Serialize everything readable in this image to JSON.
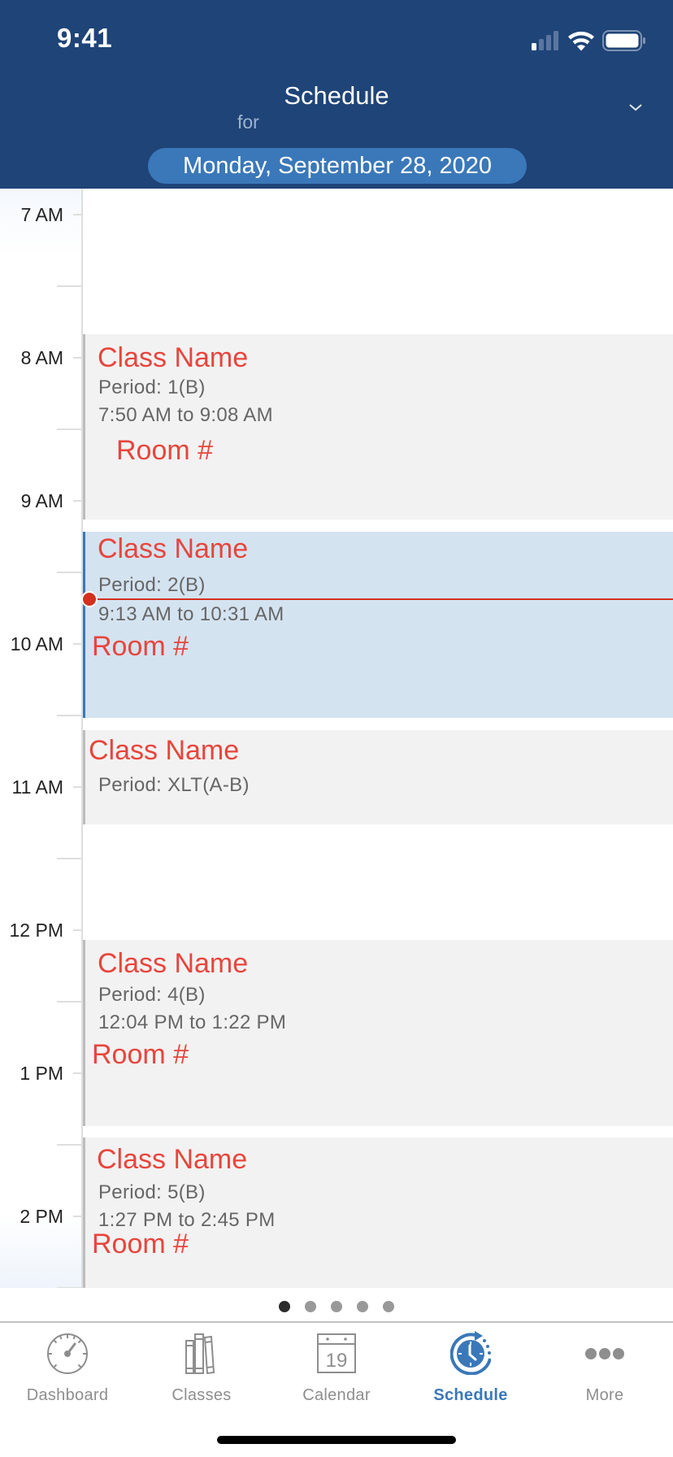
{
  "status_bar": {
    "time": "9:41",
    "icons": [
      "cellular-signal-icon",
      "wifi-icon",
      "battery-icon"
    ]
  },
  "header": {
    "title": "Schedule",
    "for_label": "for",
    "date": "Monday, September 28, 2020",
    "dropdown_icon": "chevron-down-icon"
  },
  "timeline": {
    "hours": [
      "7 AM",
      "8 AM",
      "9 AM",
      "10 AM",
      "11 AM",
      "12 PM",
      "1 PM",
      "2 PM"
    ],
    "current_time_indicator": true
  },
  "classes": [
    {
      "name": "Class Name",
      "period": "Period: 1(B)",
      "time": "7:50 AM to 9:08 AM",
      "room": "Room #",
      "current": false
    },
    {
      "name": "Class Name",
      "period": "Period: 2(B)",
      "time": "9:13 AM to 10:31 AM",
      "room": "Room #",
      "current": true
    },
    {
      "name": "Class Name",
      "period": "Period: XLT(A-B)",
      "time": "",
      "room": "",
      "current": false
    },
    {
      "name": "Class Name",
      "period": "Period: 4(B)",
      "time": "12:04 PM to 1:22 PM",
      "room": "Room #",
      "current": false
    },
    {
      "name": "Class Name",
      "period": "Period: 5(B)",
      "time": "1:27 PM to 2:45 PM",
      "room": "Room #",
      "current": false
    }
  ],
  "pager": {
    "pages": 5,
    "active_page": 1
  },
  "tabbar": {
    "tabs": [
      {
        "label": "Dashboard",
        "icon": "gauge-icon",
        "active": false
      },
      {
        "label": "Classes",
        "icon": "books-icon",
        "active": false
      },
      {
        "label": "Calendar",
        "icon": "calendar-icon",
        "icon_text": "19",
        "active": false
      },
      {
        "label": "Schedule",
        "icon": "clock-history-icon",
        "active": true
      },
      {
        "label": "More",
        "icon": "more-dots-icon",
        "active": false
      }
    ]
  },
  "colors": {
    "header_bg": "#1f4477",
    "accent": "#3a78b9",
    "class_text": "#e8453c",
    "now_line": "#d3301f",
    "current_block_bg": "#d4e3f0",
    "block_bg": "#f2f2f2"
  }
}
